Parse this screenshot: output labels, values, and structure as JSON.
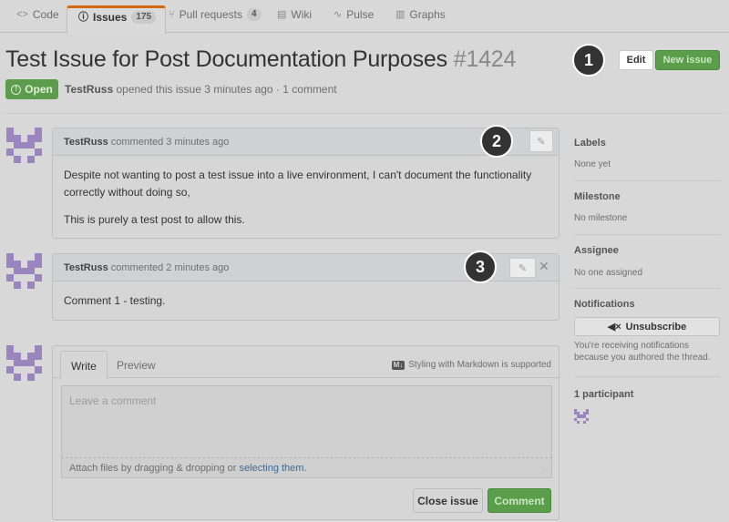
{
  "tabs": [
    {
      "icon": "code-icon",
      "label": "Code"
    },
    {
      "icon": "issue-icon",
      "label": "Issues",
      "count": "175"
    },
    {
      "icon": "pull-request-icon",
      "label": "Pull requests",
      "count": "4"
    },
    {
      "icon": "wiki-icon",
      "label": "Wiki"
    },
    {
      "icon": "pulse-icon",
      "label": "Pulse"
    },
    {
      "icon": "graph-icon",
      "label": "Graphs"
    }
  ],
  "issue": {
    "title": "Test Issue for Post Documentation Purposes",
    "number": "#1424",
    "state": "Open",
    "author": "TestRuss",
    "meta_text": "opened this issue 3 minutes ago · 1 comment"
  },
  "header_buttons": {
    "edit": "Edit",
    "new_issue": "New issue"
  },
  "callouts": [
    "1",
    "2",
    "3"
  ],
  "comments": [
    {
      "author": "TestRuss",
      "action": "commented 3 minutes ago",
      "paragraphs": [
        "Despite not wanting to post a test issue into a live environment, I can't document the functionality correctly without doing so,",
        "This is purely a test post to allow this."
      ]
    },
    {
      "author": "TestRuss",
      "action": "commented 2 minutes ago",
      "paragraphs": [
        "Comment 1 - testing."
      ]
    }
  ],
  "sidebar": {
    "labels": {
      "heading": "Labels",
      "value": "None yet"
    },
    "milestone": {
      "heading": "Milestone",
      "value": "No milestone"
    },
    "assignee": {
      "heading": "Assignee",
      "value": "No one assigned"
    },
    "notifications": {
      "heading": "Notifications",
      "button": "Unsubscribe",
      "text": "You're receiving notifications because you authored the thread."
    },
    "participants": {
      "heading": "1 participant"
    }
  },
  "composer": {
    "write_tab": "Write",
    "preview_tab": "Preview",
    "markdown_hint": "Styling with Markdown is supported",
    "markdown_icon": "M↓",
    "placeholder": "Leave a comment",
    "attach_text": "Attach files by dragging & dropping or",
    "attach_link": "selecting them",
    "attach_end": ".",
    "close_button": "Close issue",
    "comment_button": "Comment"
  },
  "colors": {
    "accent_tab": "#d26911",
    "open_green": "#5d9c4c",
    "avatar": "#9a85be"
  }
}
